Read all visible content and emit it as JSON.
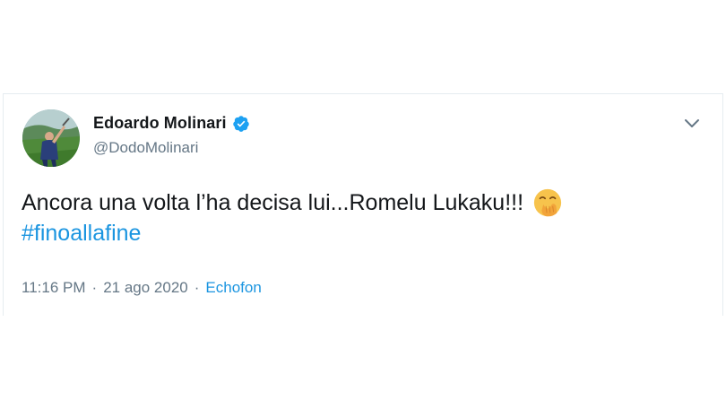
{
  "tweet": {
    "display_name": "Edoardo Molinari",
    "handle": "@DodoMolinari",
    "text_line1": "Ancora una volta l’ha decisa lui...Romelu Lukaku!!!",
    "hashtag": "#finoallafine",
    "time": "11:16 PM",
    "separator": "·",
    "date": "21 ago 2020",
    "source": "Echofon",
    "icons": {
      "verified": "verified-badge-icon",
      "menu": "chevron-down-icon",
      "emoji": "face-with-hand-over-mouth-emoji"
    },
    "colors": {
      "link": "#1b95e0",
      "verified": "#1da1f2",
      "text": "#14171a",
      "muted": "#657786"
    }
  }
}
